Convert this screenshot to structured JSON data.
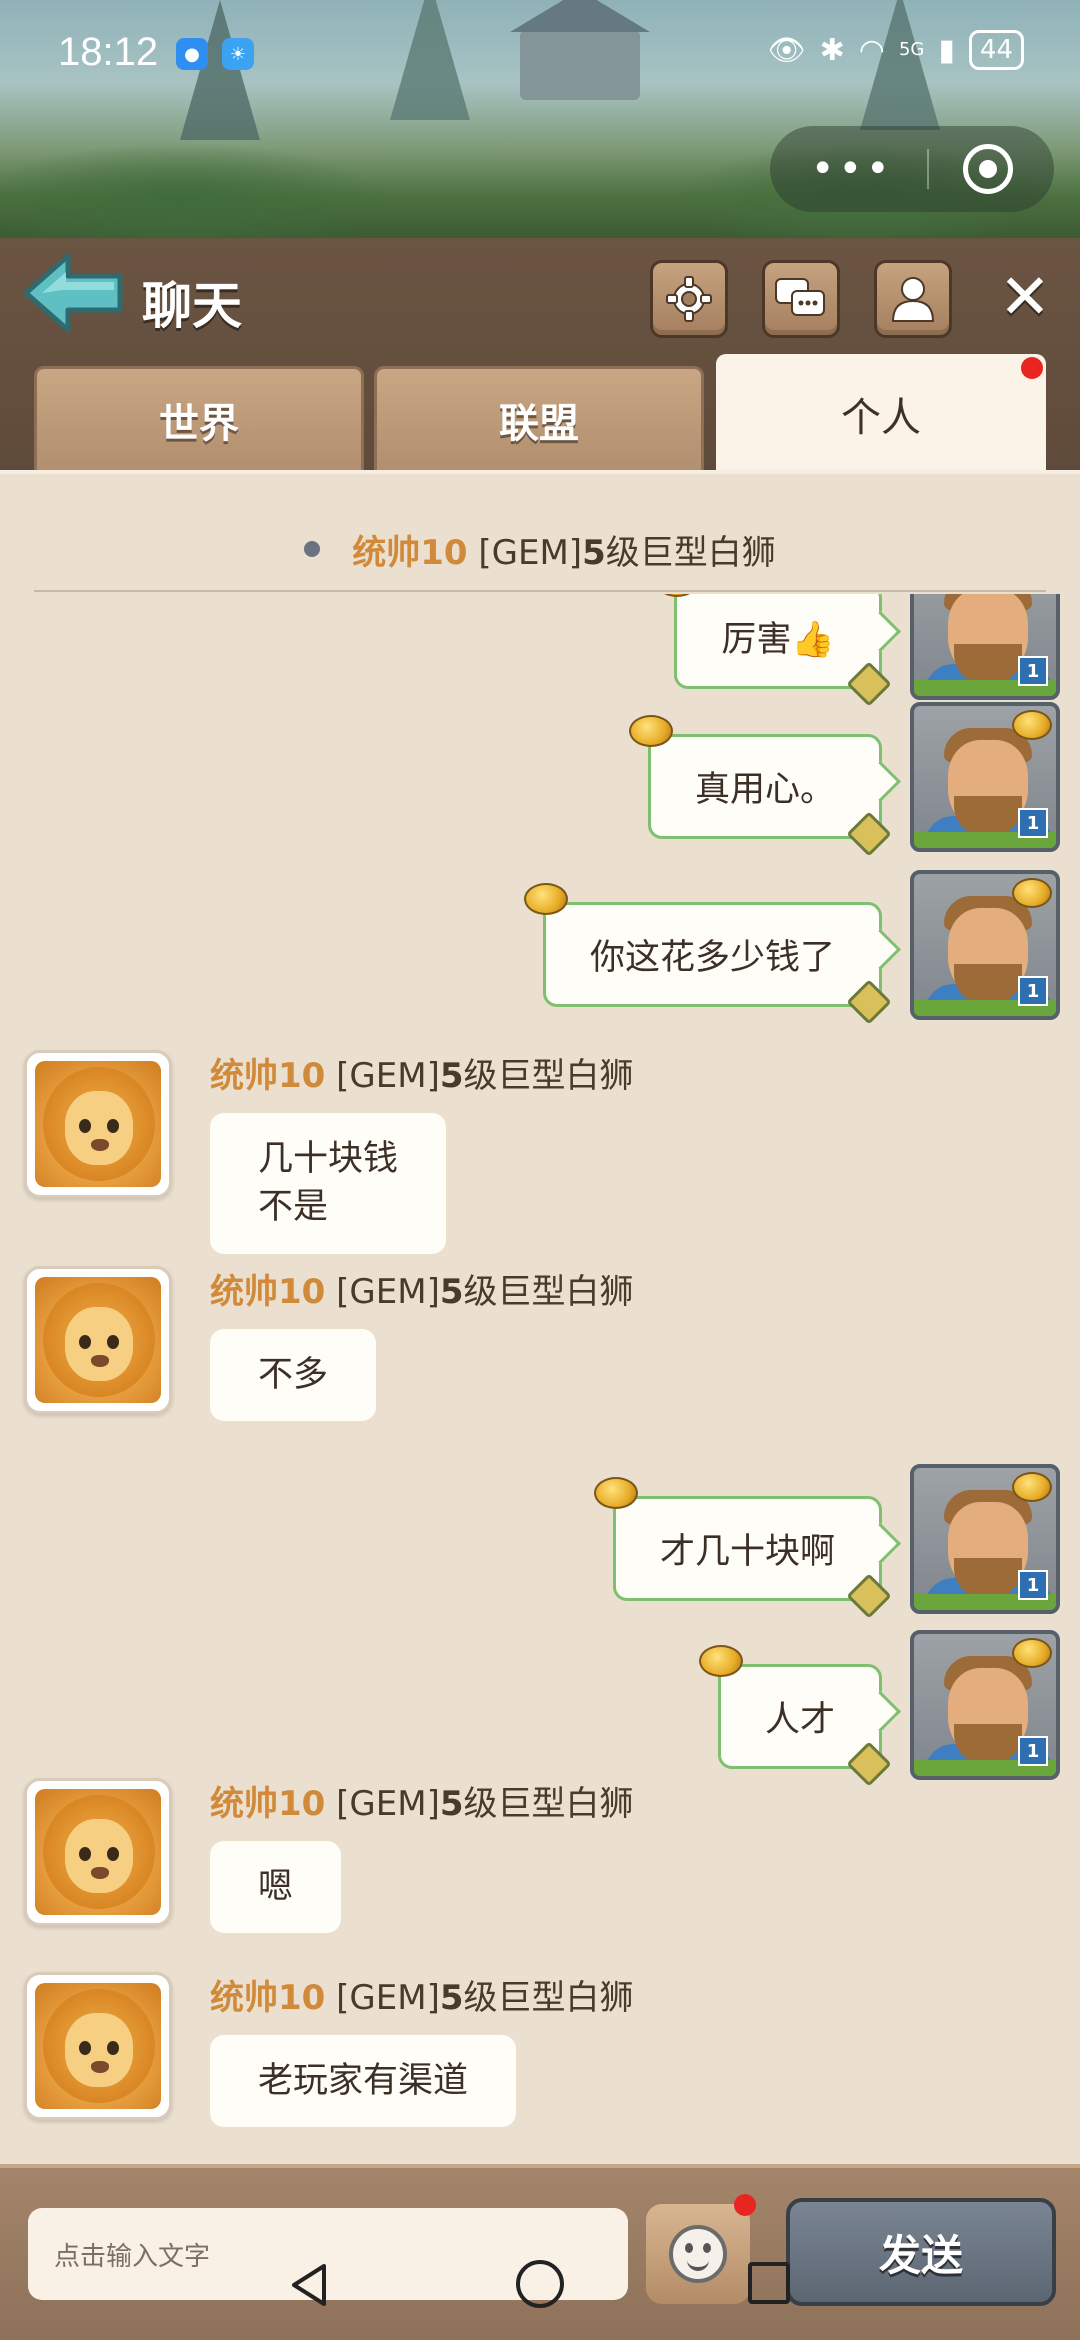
{
  "status_bar": {
    "time": "18:12",
    "network": "5G",
    "battery": "44"
  },
  "header": {
    "title": "聊天",
    "tabs": [
      {
        "label": "世界"
      },
      {
        "label": "联盟"
      },
      {
        "label": "个人"
      }
    ]
  },
  "pinned": {
    "rank": "统帅10",
    "tag": "[GEM]",
    "level": "5",
    "name_suffix": "级巨型白狮"
  },
  "messages": [
    {
      "side": "right",
      "text": "厉害👍"
    },
    {
      "side": "right",
      "text": "真用心。"
    },
    {
      "side": "right",
      "text": "你这花多少钱了"
    },
    {
      "side": "left",
      "rank": "统帅10",
      "tag": "[GEM]",
      "level": "5",
      "name_suffix": "级巨型白狮",
      "line1": "几十块钱",
      "line2": "不是"
    },
    {
      "side": "left",
      "rank": "统帅10",
      "tag": "[GEM]",
      "level": "5",
      "name_suffix": "级巨型白狮",
      "text": "不多"
    },
    {
      "side": "right",
      "text": "才几十块啊"
    },
    {
      "side": "right",
      "text": "人才"
    },
    {
      "side": "left",
      "rank": "统帅10",
      "tag": "[GEM]",
      "level": "5",
      "name_suffix": "级巨型白狮",
      "text": "嗯"
    },
    {
      "side": "left",
      "rank": "统帅10",
      "tag": "[GEM]",
      "level": "5",
      "name_suffix": "级巨型白狮",
      "text": "老玩家有渠道"
    }
  ],
  "input": {
    "placeholder": "点击输入文字",
    "send_label": "发送"
  },
  "icons": {
    "back": "back-arrow-icon",
    "settings": "gear-icon",
    "chat": "chat-bubbles-icon",
    "profile": "person-icon",
    "close": "close-icon",
    "emoji": "smiley-icon"
  },
  "colors": {
    "header_bg": "#6b5442",
    "chat_bg": "#ebdfcf",
    "rank_text": "#d08a3a",
    "own_bubble_border": "#7fc070",
    "send_button": "#6b7582",
    "notification_dot": "#e8261f"
  }
}
